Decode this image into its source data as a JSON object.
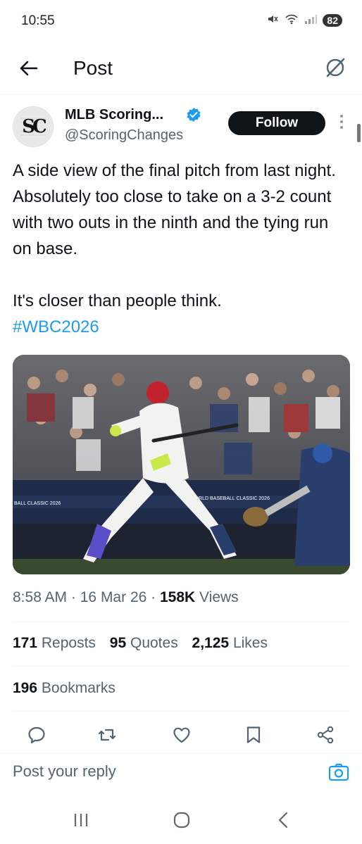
{
  "status_bar": {
    "time": "10:55",
    "battery": "82",
    "signal_label": "6"
  },
  "header": {
    "title": "Post"
  },
  "author": {
    "avatar_initials": "SC",
    "name": "MLB Scoring...",
    "handle": "@ScoringChanges",
    "follow_label": "Follow"
  },
  "post": {
    "paragraph1": "A side view of the final pitch from last night. Absolutely too close to take on a 3-2 count with two outs in the ninth and the tying run on base.",
    "paragraph2": "It's closer than people think.",
    "hashtag": "#WBC2026"
  },
  "media": {
    "banner1": "BALL CLASSIC 2026",
    "banner2": "WORLD BASEBALL CLASSIC 2026"
  },
  "meta": {
    "time": "8:58 AM",
    "sep": "·",
    "date": "16 Mar 26",
    "views_count": "158K",
    "views_label": "Views"
  },
  "stats": {
    "reposts_count": "171",
    "reposts_label": "Reposts",
    "quotes_count": "95",
    "quotes_label": "Quotes",
    "likes_count": "2,125",
    "likes_label": "Likes",
    "bookmarks_count": "196",
    "bookmarks_label": "Bookmarks"
  },
  "reply": {
    "placeholder": "Post your reply"
  },
  "icons": [
    "back-arrow-icon",
    "grok-icon",
    "verified-badge-icon",
    "more-icon",
    "reply-icon",
    "repost-icon",
    "like-icon",
    "bookmark-icon",
    "share-icon",
    "camera-icon",
    "recents-icon",
    "home-icon",
    "back-icon"
  ],
  "colors": {
    "accent": "#1d9bf0",
    "text": "#0f1419",
    "secondary": "#536471",
    "follow_bg": "#0f1419"
  }
}
